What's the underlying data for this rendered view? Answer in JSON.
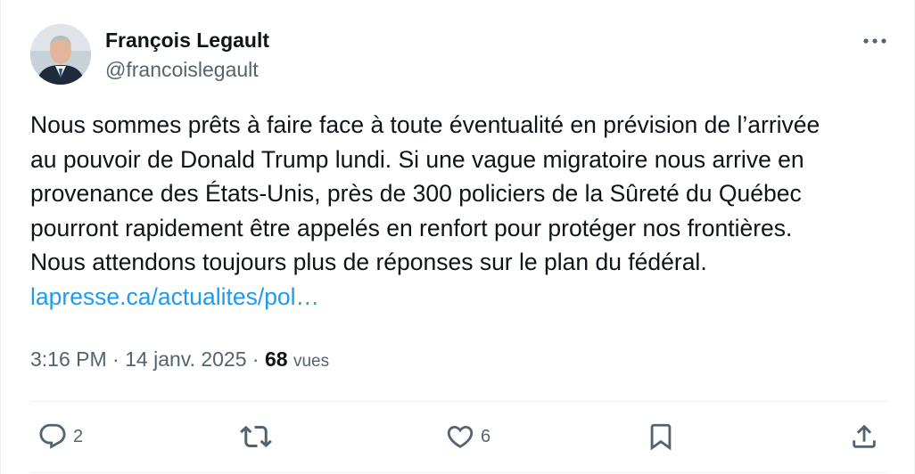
{
  "author": {
    "name": "François Legault",
    "handle": "@francoislegault"
  },
  "tweet": {
    "lines": [
      "Nous sommes prêts à faire face à toute éventualité en prévision de l’arrivée",
      "au pouvoir de Donald Trump lundi. Si une vague migratoire nous arrive en",
      "provenance des États-Unis, près de 300 policiers de la Sûreté du Québec",
      "pourront rapidement être appelés en renfort pour protéger nos frontières.",
      "Nous attendons toujours plus de réponses sur le plan du fédéral."
    ],
    "link_text": "lapresse.ca/actualites/pol…"
  },
  "meta": {
    "time": "3:16 PM",
    "separator": " · ",
    "date": "14 janv. 2025",
    "views_count": "68",
    "views_label": "vues"
  },
  "actions": {
    "reply_count": "2",
    "like_count": "6"
  },
  "icons": {
    "more": "more-horizontal-icon",
    "reply": "reply-icon",
    "retweet": "retweet-icon",
    "like": "heart-icon",
    "bookmark": "bookmark-icon",
    "share": "share-icon"
  },
  "colors": {
    "text": "#0f1419",
    "secondary": "#536471",
    "link": "#1d9bf0",
    "divider": "#eff3f4"
  }
}
